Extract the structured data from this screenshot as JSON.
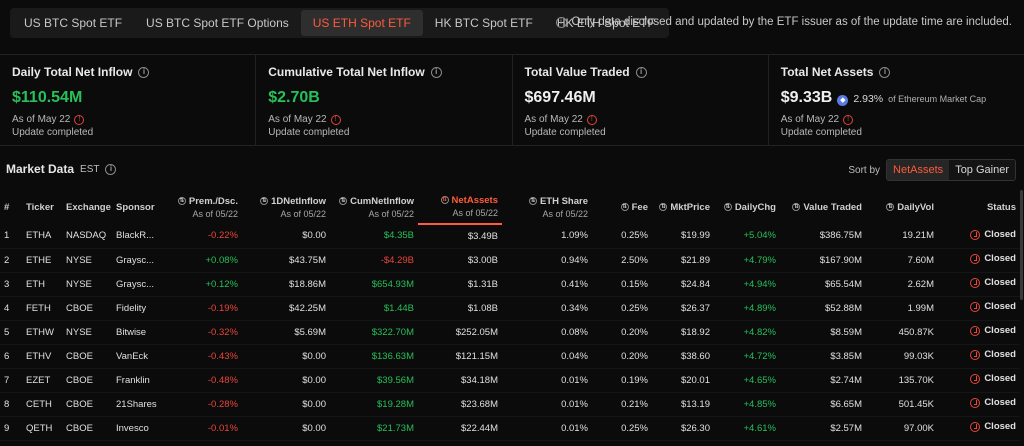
{
  "tabs": [
    {
      "label": "US BTC Spot ETF",
      "active": false
    },
    {
      "label": "US BTC Spot ETF Options",
      "active": false
    },
    {
      "label": "US ETH Spot ETF",
      "active": true
    },
    {
      "label": "HK BTC Spot ETF",
      "active": false
    },
    {
      "label": "HK ETH Spot ETF",
      "active": false
    }
  ],
  "notice": "Only data disclosed and updated by the ETF issuer as of the update time are included.",
  "cards": {
    "daily": {
      "label": "Daily Total Net Inflow",
      "value": "$110.54M",
      "as_of": "As of May 22",
      "status": "Update completed"
    },
    "cumulative": {
      "label": "Cumulative Total Net Inflow",
      "value": "$2.70B",
      "as_of": "As of May 22",
      "status": "Update completed"
    },
    "traded": {
      "label": "Total Value Traded",
      "value": "$697.46M",
      "as_of": "As of May 22",
      "status": "Update completed"
    },
    "assets": {
      "label": "Total Net Assets",
      "value": "$9.33B",
      "pct": "2.93%",
      "pct_label": "of Ethereum Market Cap",
      "as_of": "As of May 22",
      "status": "Update completed"
    }
  },
  "market": {
    "title": "Market Data",
    "tz": "EST",
    "sort_label": "Sort by",
    "sort_options": [
      "NetAssets",
      "Top Gainer"
    ]
  },
  "table": {
    "headers": {
      "num": "#",
      "ticker": "Ticker",
      "exchange": "Exchange",
      "sponsor": "Sponsor",
      "prem": "Prem./Dsc.",
      "prem_sub": "As of 05/22",
      "inflow": "1DNetInflow",
      "inflow_sub": "As of 05/22",
      "cum": "CumNetInflow",
      "cum_sub": "As of 05/22",
      "assets": "NetAssets",
      "assets_sub": "As of 05/22",
      "share": "ETH Share",
      "share_sub": "As of 05/22",
      "fee": "Fee",
      "price": "MktPrice",
      "chg": "DailyChg",
      "traded": "Value Traded",
      "vol": "DailyVol",
      "status": "Status"
    },
    "rows": [
      {
        "num": "1",
        "ticker": "ETHA",
        "exchange": "NASDAQ",
        "sponsor": "BlackR...",
        "prem": "-0.22%",
        "inflow": "$0.00",
        "cum": "$4.35B",
        "assets": "$3.49B",
        "share": "1.09%",
        "fee": "0.25%",
        "price": "$19.99",
        "chg": "+5.04%",
        "traded": "$386.75M",
        "vol": "19.21M",
        "status": "Closed"
      },
      {
        "num": "2",
        "ticker": "ETHE",
        "exchange": "NYSE",
        "sponsor": "Graysc...",
        "prem": "+0.08%",
        "inflow": "$43.75M",
        "cum": "-$4.29B",
        "assets": "$3.00B",
        "share": "0.94%",
        "fee": "2.50%",
        "price": "$21.89",
        "chg": "+4.79%",
        "traded": "$167.90M",
        "vol": "7.60M",
        "status": "Closed"
      },
      {
        "num": "3",
        "ticker": "ETH",
        "exchange": "NYSE",
        "sponsor": "Graysc...",
        "prem": "+0.12%",
        "inflow": "$18.86M",
        "cum": "$654.93M",
        "assets": "$1.31B",
        "share": "0.41%",
        "fee": "0.15%",
        "price": "$24.84",
        "chg": "+4.94%",
        "traded": "$65.54M",
        "vol": "2.62M",
        "status": "Closed"
      },
      {
        "num": "4",
        "ticker": "FETH",
        "exchange": "CBOE",
        "sponsor": "Fidelity",
        "prem": "-0.19%",
        "inflow": "$42.25M",
        "cum": "$1.44B",
        "assets": "$1.08B",
        "share": "0.34%",
        "fee": "0.25%",
        "price": "$26.37",
        "chg": "+4.89%",
        "traded": "$52.88M",
        "vol": "1.99M",
        "status": "Closed"
      },
      {
        "num": "5",
        "ticker": "ETHW",
        "exchange": "NYSE",
        "sponsor": "Bitwise",
        "prem": "-0.32%",
        "inflow": "$5.69M",
        "cum": "$322.70M",
        "assets": "$252.05M",
        "share": "0.08%",
        "fee": "0.20%",
        "price": "$18.92",
        "chg": "+4.82%",
        "traded": "$8.59M",
        "vol": "450.87K",
        "status": "Closed"
      },
      {
        "num": "6",
        "ticker": "ETHV",
        "exchange": "CBOE",
        "sponsor": "VanEck",
        "prem": "-0.43%",
        "inflow": "$0.00",
        "cum": "$136.63M",
        "assets": "$121.15M",
        "share": "0.04%",
        "fee": "0.20%",
        "price": "$38.60",
        "chg": "+4.72%",
        "traded": "$3.85M",
        "vol": "99.03K",
        "status": "Closed"
      },
      {
        "num": "7",
        "ticker": "EZET",
        "exchange": "CBOE",
        "sponsor": "Franklin",
        "prem": "-0.48%",
        "inflow": "$0.00",
        "cum": "$39.56M",
        "assets": "$34.18M",
        "share": "0.01%",
        "fee": "0.19%",
        "price": "$20.01",
        "chg": "+4.65%",
        "traded": "$2.74M",
        "vol": "135.70K",
        "status": "Closed"
      },
      {
        "num": "8",
        "ticker": "CETH",
        "exchange": "CBOE",
        "sponsor": "21Shares",
        "prem": "-0.28%",
        "inflow": "$0.00",
        "cum": "$19.28M",
        "assets": "$23.68M",
        "share": "0.01%",
        "fee": "0.21%",
        "price": "$13.19",
        "chg": "+4.85%",
        "traded": "$6.65M",
        "vol": "501.45K",
        "status": "Closed"
      },
      {
        "num": "9",
        "ticker": "QETH",
        "exchange": "CBOE",
        "sponsor": "Invesco",
        "prem": "-0.01%",
        "inflow": "$0.00",
        "cum": "$21.73M",
        "assets": "$22.44M",
        "share": "0.01%",
        "fee": "0.25%",
        "price": "$26.30",
        "chg": "+4.61%",
        "traded": "$2.57M",
        "vol": "97.00K",
        "status": "Closed"
      }
    ]
  },
  "colors": {
    "positive": "#27c05a",
    "negative": "#e8463d",
    "accent": "#ff5a3c"
  }
}
